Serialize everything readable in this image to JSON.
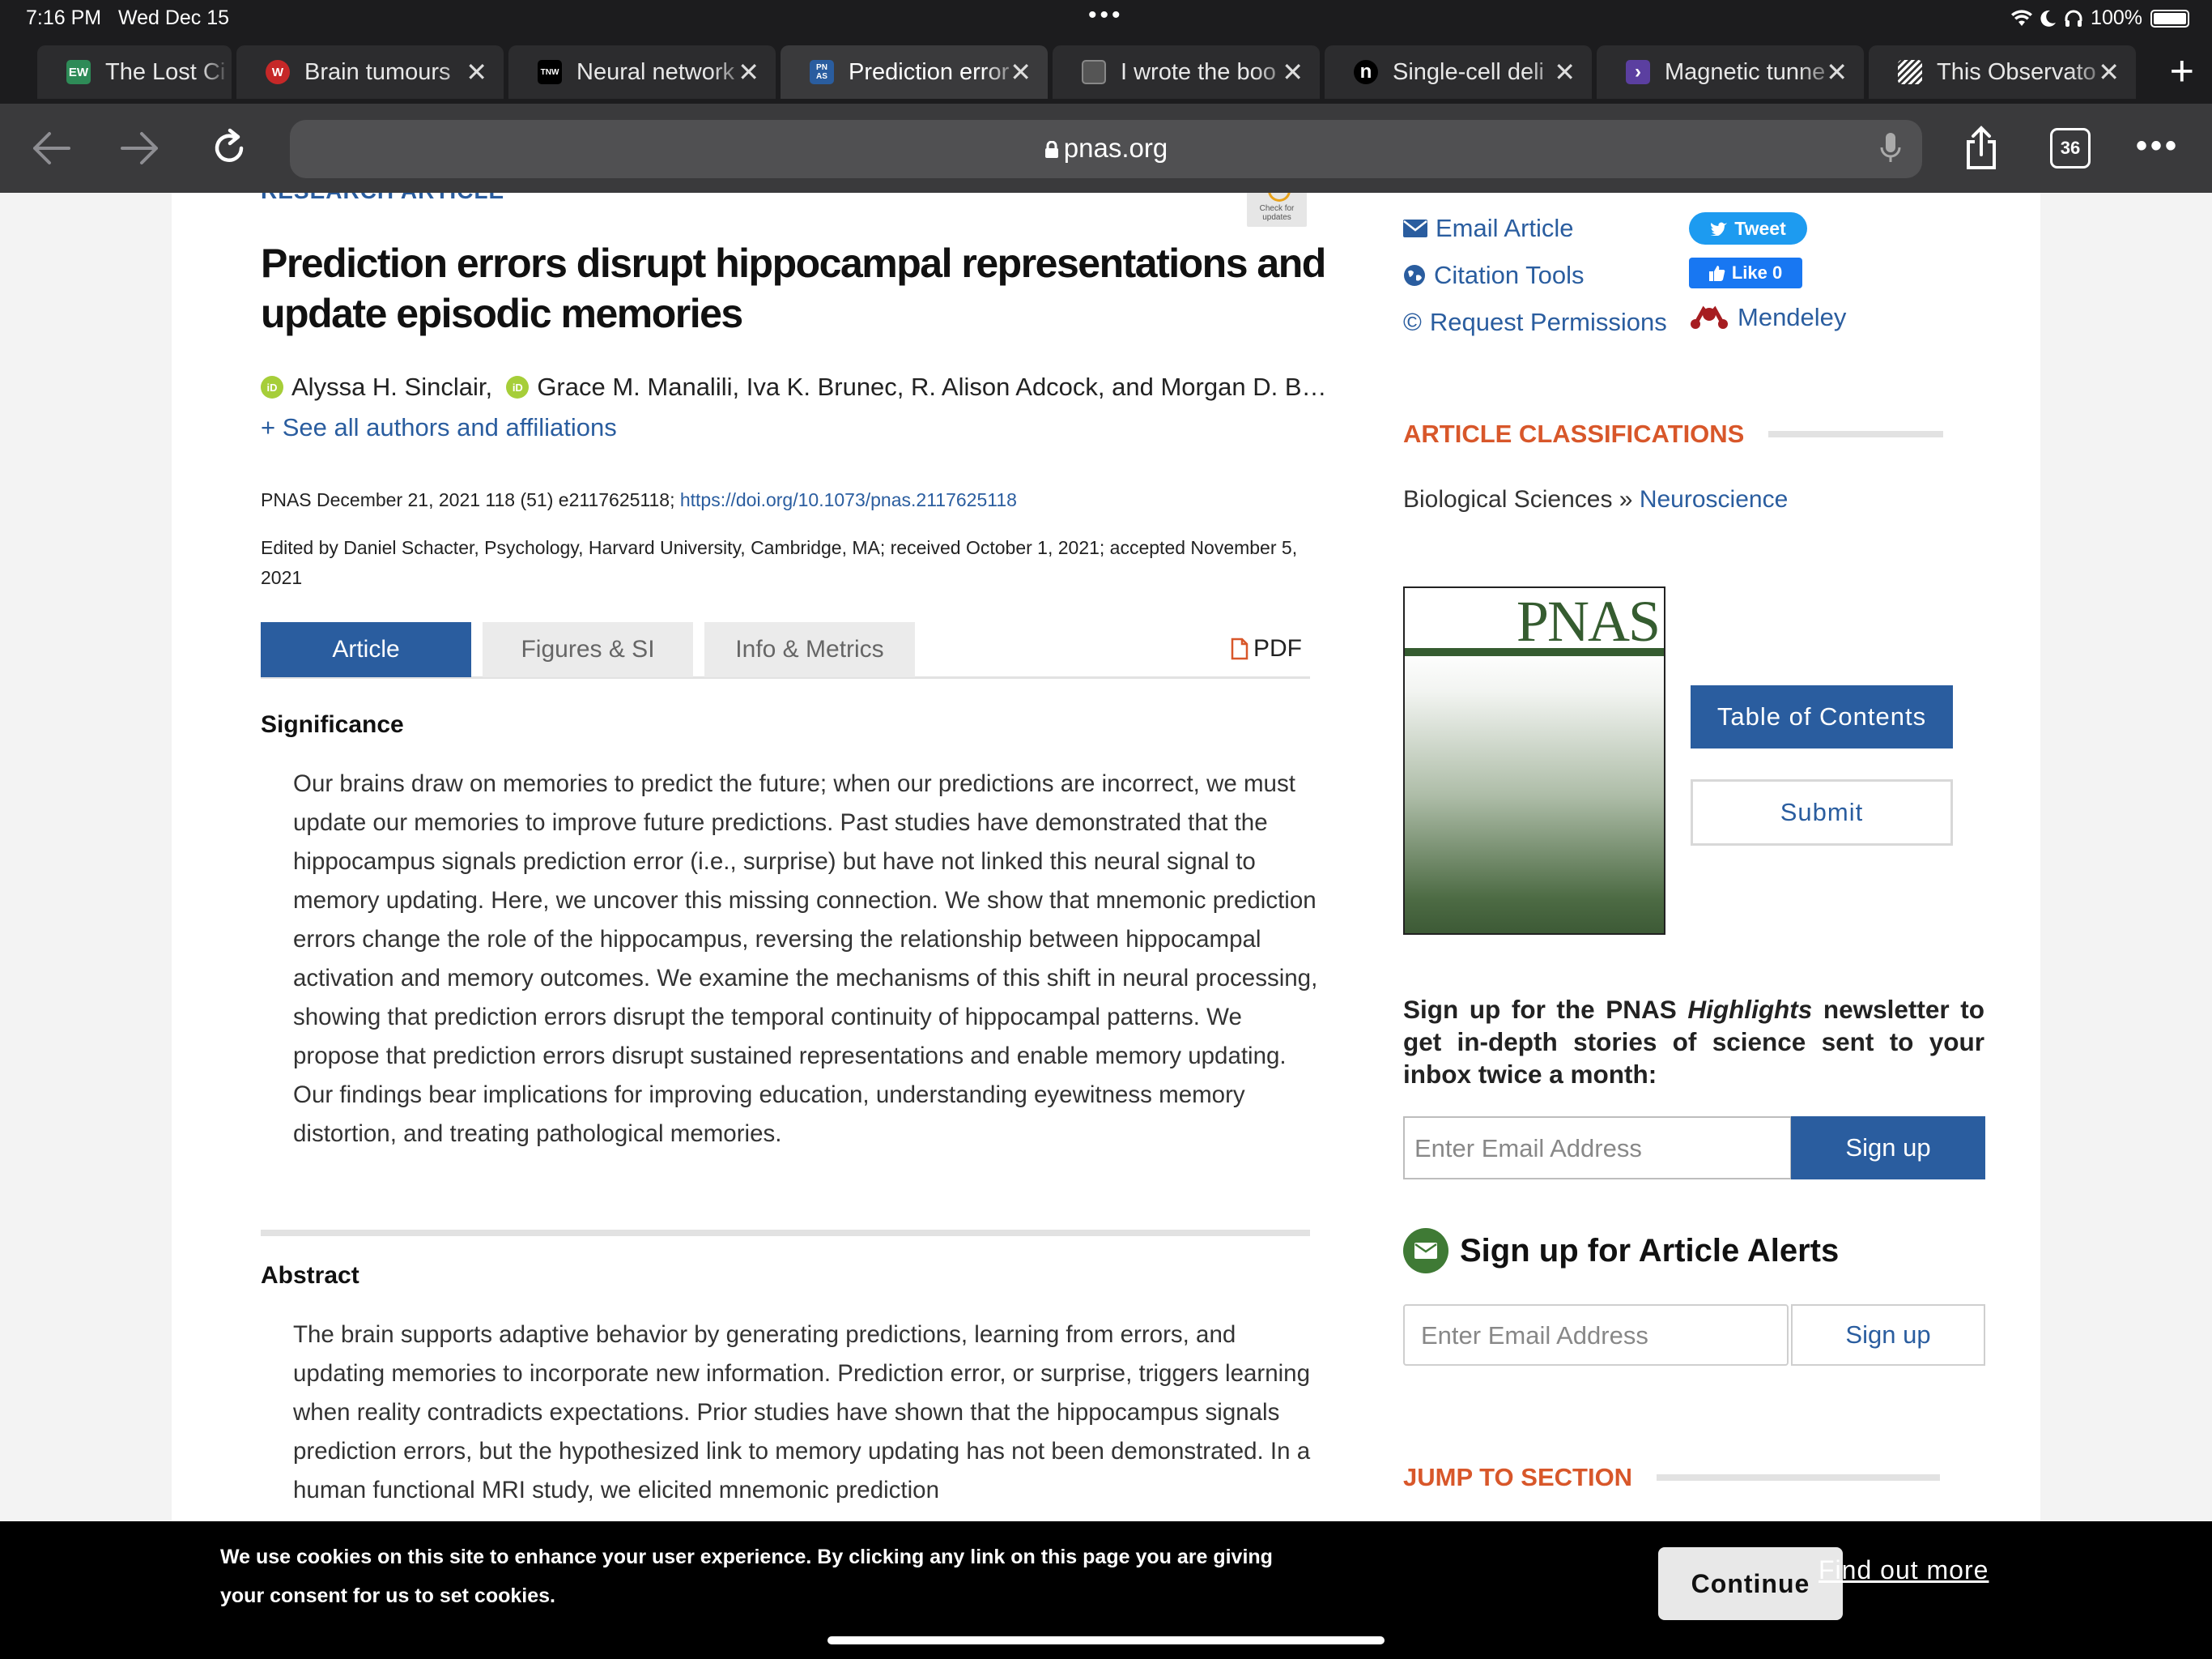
{
  "status": {
    "time": "7:16 PM",
    "date": "Wed Dec 15",
    "battery": "100%"
  },
  "tabs": [
    {
      "label": "The Lost Ci",
      "icon": "ew-favicon",
      "icon_text": "EW",
      "icon_bg": "#2e8b57"
    },
    {
      "label": "Brain tumours",
      "icon": "red-circle-favicon",
      "icon_text": "W",
      "icon_bg": "#c62828"
    },
    {
      "label": "Neural network",
      "icon": "tnw-favicon",
      "icon_text": "TNW",
      "icon_bg": "#000000"
    },
    {
      "label": "Prediction error",
      "icon": "pnas-favicon",
      "icon_text": "PN AS",
      "icon_bg": "#2a5d9f",
      "active": true
    },
    {
      "label": "I wrote the boo",
      "icon": "grey-square-favicon",
      "icon_text": "",
      "icon_bg": "#555555"
    },
    {
      "label": "Single-cell deli",
      "icon": "n-favicon",
      "icon_text": "n",
      "icon_bg": "#000000"
    },
    {
      "label": "Magnetic tunne",
      "icon": "purple-arrow-favicon",
      "icon_text": "›",
      "icon_bg": "#5b3fa0"
    },
    {
      "label": "This Observato",
      "icon": "stripes-favicon",
      "icon_text": "",
      "icon_bg": "#333333"
    }
  ],
  "toolbar": {
    "url": "pnas.org",
    "tab_count": "36"
  },
  "article": {
    "type_label": "RESEARCH ARTICLE",
    "check_updates": "Check for updates",
    "title": "Prediction errors disrupt hippocampal representations and update episodic memories",
    "authors": [
      "Alyssa H. Sinclair,",
      "Grace M. Manalili, Iva K. Brunec, R. Alison Adcock, and Morgan D. B…"
    ],
    "see_all": "+ See all authors and affiliations",
    "citation": "PNAS December 21, 2021 118 (51) e2117625118; ",
    "doi": "https://doi.org/10.1073/pnas.2117625118",
    "edited": "Edited by Daniel Schacter, Psychology, Harvard University, Cambridge, MA; received October 1, 2021; accepted November 5, 2021",
    "tabs": [
      "Article",
      "Figures & SI",
      "Info & Metrics"
    ],
    "pdf": "PDF",
    "significance_head": "Significance",
    "significance": "Our brains draw on memories to predict the future; when our predictions are incorrect, we must update our memories to improve future predictions. Past studies have demonstrated that the hippocampus signals prediction error (i.e., surprise) but have not linked this neural signal to memory updating. Here, we uncover this missing connection. We show that mnemonic prediction errors change the role of the hippocampus, reversing the relationship between hippocampal activation and memory outcomes. We examine the mechanisms of this shift in neural processing, showing that prediction errors disrupt the temporal continuity of hippocampal patterns. We propose that prediction errors disrupt sustained representations and enable memory updating. Our findings bear implications for improving education, understanding eyewitness memory distortion, and treating pathological memories.",
    "abstract_head": "Abstract",
    "abstract": "The brain supports adaptive behavior by generating predictions, learning from errors, and updating memories to incorporate new information. Prediction error, or surprise, triggers learning when reality contradicts expectations. Prior studies have shown that the hippocampus signals prediction errors, but the hypothesized link to memory updating has not been demonstrated. In a human functional MRI study, we elicited mnemonic prediction"
  },
  "sidebar": {
    "email_article": "Email Article",
    "citation_tools": "Citation Tools",
    "request_permissions": "Request Permissions",
    "tweet": "Tweet",
    "like": "Like 0",
    "mendeley": "Mendeley",
    "classifications_head": "ARTICLE CLASSIFICATIONS",
    "class_field": "Biological Sciences » ",
    "class_link": "Neuroscience",
    "cover_title": "PNAS",
    "toc_button": "Table of Contents",
    "submit_button": "Submit",
    "newsletter_pre": "Sign up for the PNAS ",
    "newsletter_em": "Highlights",
    "newsletter_post": " newsletter to get in-depth stories of science sent to your inbox twice a month:",
    "newsletter_placeholder": "Enter Email Address",
    "newsletter_button": "Sign up",
    "alerts_head": "Sign up for Article Alerts",
    "alerts_placeholder": "Enter Email Address",
    "alerts_button": "Sign up",
    "jump_head": "JUMP TO SECTION"
  },
  "cookie": {
    "text": "We use cookies on this site to enhance your user experience. By clicking any link on this page you are giving your consent for us to set cookies.",
    "continue": "Continue",
    "find_out": "Find out more"
  },
  "colors": {
    "link": "#2a5d9f",
    "accent_orange": "#d8572a",
    "pnas_green": "#355c30"
  }
}
